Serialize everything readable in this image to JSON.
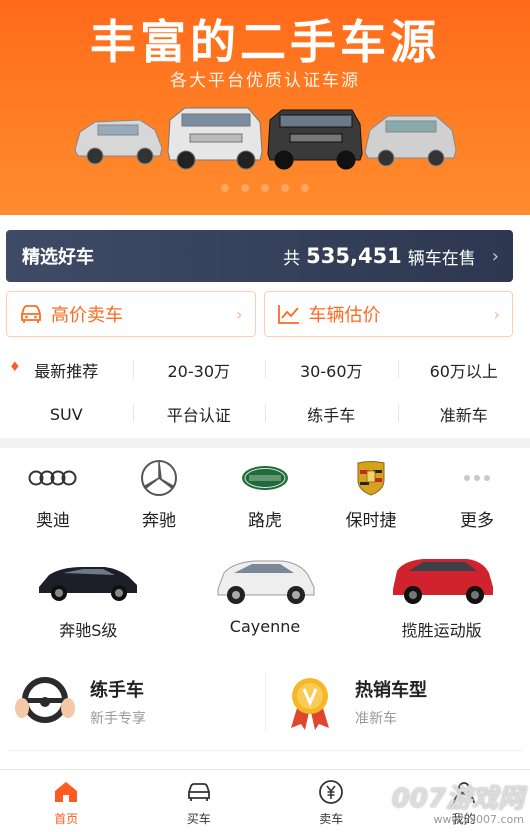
{
  "banner": {
    "title": "丰富的二手车源",
    "subtitle": "各大平台优质认证车源"
  },
  "picks": {
    "title": "精选好车",
    "prefix": "共",
    "count": "535,451",
    "suffix": "辆车在售"
  },
  "actions": [
    {
      "label": "高价卖车",
      "icon": "car-icon"
    },
    {
      "label": "车辆估价",
      "icon": "trend-chart-icon"
    }
  ],
  "quick_filters": {
    "row1": [
      "最新推荐",
      "20-30万",
      "30-60万",
      "60万以上"
    ],
    "row2": [
      "SUV",
      "平台认证",
      "练手车",
      "准新车"
    ]
  },
  "brands": [
    "奥迪",
    "奔驰",
    "路虎",
    "保时捷",
    "更多"
  ],
  "models": [
    "奔驰S级",
    "Cayenne",
    "揽胜运动版"
  ],
  "features": [
    {
      "title": "练手车",
      "subtitle": "新手专享"
    },
    {
      "title": "热销车型",
      "subtitle": "准新车"
    }
  ],
  "nav": [
    "首页",
    "买车",
    "卖车",
    "我的"
  ],
  "watermark": {
    "line1": "007游戏网",
    "line2": "www.yx007.com"
  },
  "colors": {
    "accent": "#ff5a1f",
    "banner": "#ff7420",
    "picks_bg": "#354059"
  }
}
